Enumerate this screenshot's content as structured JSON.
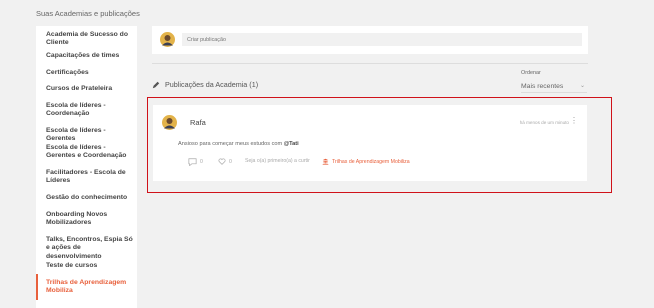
{
  "header": {
    "title": "Suas Academias e publicações"
  },
  "sidebar": {
    "items": [
      {
        "label": "Academia de Sucesso do Cliente"
      },
      {
        "label": "Capacitações de times"
      },
      {
        "label": "Certificações"
      },
      {
        "label": "Cursos de Prateleira"
      },
      {
        "label": "Escola de líderes - Coordenação"
      },
      {
        "label": "Escola de líderes - Gerentes"
      },
      {
        "label": "Escola de líderes - Gerentes e Coordenação"
      },
      {
        "label": "Facilitadores - Escola de Líderes"
      },
      {
        "label": "Gestão do conhecimento"
      },
      {
        "label": "Onboarding Novos Mobilizadores"
      },
      {
        "label": "Talks, Encontros, Espia Só e ações de desenvolvimento"
      },
      {
        "label": "Teste de cursos"
      },
      {
        "label": "Trilhas de Aprendizagem Mobiliza"
      }
    ],
    "active_color": "#e8603c"
  },
  "composer": {
    "placeholder": "Criar publicação"
  },
  "feed": {
    "section_title": "Publicações da Academia (1)",
    "order_label": "Ordenar",
    "order_value": "Mais recentes"
  },
  "post": {
    "author": "Rafa",
    "time": "há menos de um minuto",
    "text": "Ansioso para começar meus estudos com ",
    "mention": "@Tati",
    "comments": "0",
    "likes": "0",
    "first_like": "Seja o(a) primeiro(a) a curtir",
    "academy_tag": "Trilhas de Aprendizagem Mobiliza"
  }
}
